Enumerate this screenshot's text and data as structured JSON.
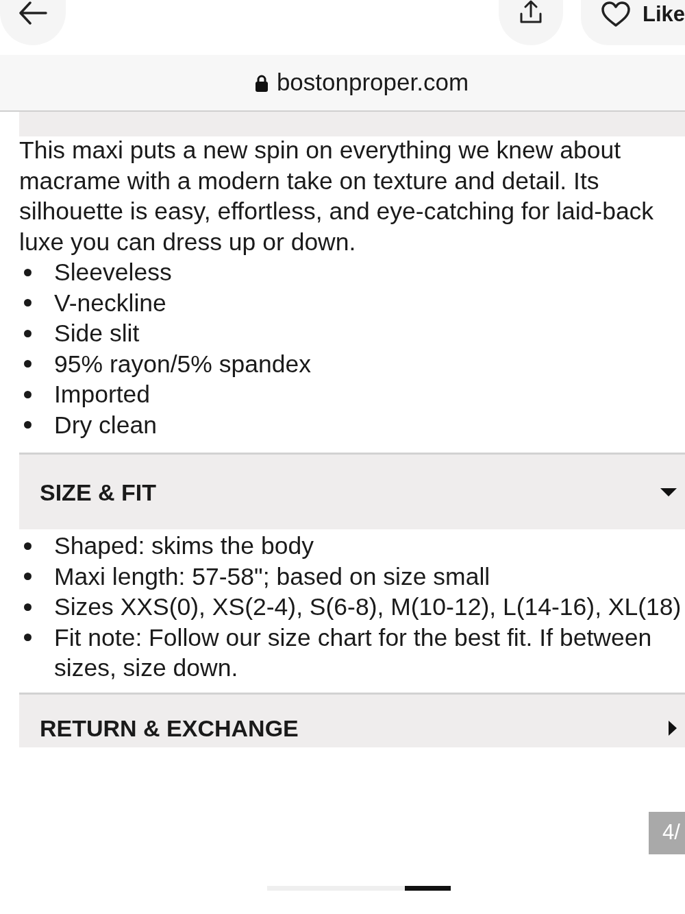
{
  "top_bar": {
    "like_label": "Like"
  },
  "address_bar": {
    "secure": true,
    "domain": "bostonproper.com"
  },
  "description": "This maxi puts a new spin on everything we knew about macrame with a modern take on texture and detail. Its silhouette is easy, effortless, and eye-catching for laid-back luxe you can dress up or down.",
  "features": [
    "Sleeveless",
    "V-neckline",
    "Side slit",
    "95% rayon/5% spandex",
    "Imported",
    "Dry clean"
  ],
  "sections": [
    {
      "title": "SIZE & FIT",
      "expanded": true,
      "items": [
        "Shaped: skims the body",
        "Maxi length: 57-58\"; based on size small",
        "Sizes XXS(0), XS(2-4), S(6-8), M(10-12), L(14-16), XL(18)",
        "Fit note: Follow our size chart for the best fit. If between sizes, size down."
      ]
    },
    {
      "title": "RETURN & EXCHANGE",
      "expanded": false
    }
  ],
  "image_counter": "4/"
}
